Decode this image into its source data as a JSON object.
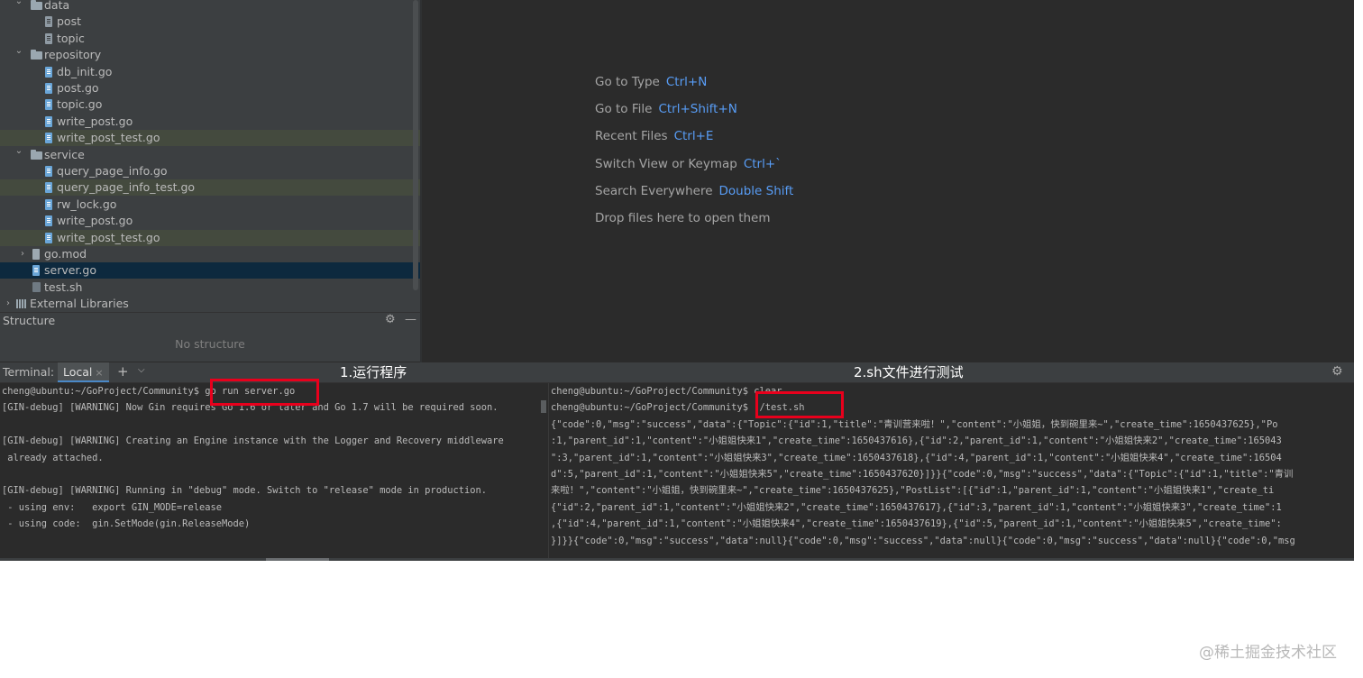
{
  "project_tree": [
    {
      "label": "data",
      "type": "folder",
      "chevron": "down"
    },
    {
      "label": "post",
      "type": "doc"
    },
    {
      "label": "topic",
      "type": "doc"
    },
    {
      "label": "repository",
      "type": "folder",
      "chevron": "down"
    },
    {
      "label": "db_init.go",
      "type": "gofile"
    },
    {
      "label": "post.go",
      "type": "gofile"
    },
    {
      "label": "topic.go",
      "type": "gofile"
    },
    {
      "label": "write_post.go",
      "type": "gofile"
    },
    {
      "label": "write_post_test.go",
      "type": "gofile",
      "highlight": true
    },
    {
      "label": "service",
      "type": "folder",
      "chevron": "down"
    },
    {
      "label": "query_page_info.go",
      "type": "gofile"
    },
    {
      "label": "query_page_info_test.go",
      "type": "gofile",
      "highlight": true
    },
    {
      "label": "rw_lock.go",
      "type": "gofile"
    },
    {
      "label": "write_post.go",
      "type": "gofile"
    },
    {
      "label": "write_post_test.go",
      "type": "gofile",
      "highlight": true
    },
    {
      "label": "go.mod",
      "type": "mod",
      "chevron": "right"
    },
    {
      "label": "server.go",
      "type": "gofile",
      "selected": true
    },
    {
      "label": "test.sh",
      "type": "sh"
    },
    {
      "label": "External Libraries",
      "type": "lib",
      "chevron": "right"
    }
  ],
  "structure": {
    "title": "Structure",
    "empty_text": "No structure"
  },
  "editor_hints": [
    {
      "label": "Go to Type",
      "key": "Ctrl+N"
    },
    {
      "label": "Go to File",
      "key": "Ctrl+Shift+N"
    },
    {
      "label": "Recent Files",
      "key": "Ctrl+E"
    },
    {
      "label": "Switch View or Keymap",
      "key": "Ctrl+`"
    },
    {
      "label": "Search Everywhere",
      "key": "Double Shift"
    },
    {
      "label": "Drop files here to open them",
      "key": ""
    }
  ],
  "terminal": {
    "title": "Terminal:",
    "tab_label": "Local",
    "tab_close": "×",
    "add_symbol": "+",
    "dropdown_symbol": "⌄",
    "annotation_left": "1.运行程序",
    "annotation_right": "2.sh文件进行测试",
    "left_lines": [
      "cheng@ubuntu:~/GoProject/Community$ go run server.go",
      "[GIN-debug] [WARNING] Now Gin requires Go 1.6 or later and Go 1.7 will be required soon.",
      "",
      "[GIN-debug] [WARNING] Creating an Engine instance with the Logger and Recovery middleware",
      " already attached.",
      "",
      "[GIN-debug] [WARNING] Running in \"debug\" mode. Switch to \"release\" mode in production.",
      " - using env:   export GIN_MODE=release",
      " - using code:  gin.SetMode(gin.ReleaseMode)"
    ],
    "right_lines": [
      "cheng@ubuntu:~/GoProject/Community$ clear",
      "cheng@ubuntu:~/GoProject/Community$ ./test.sh",
      "{\"code\":0,\"msg\":\"success\",\"data\":{\"Topic\":{\"id\":1,\"title\":\"青训营来啦！\",\"content\":\"小姐姐，快到碗里来~\",\"create_time\":1650437625},\"Po",
      ":1,\"parent_id\":1,\"content\":\"小姐姐快来1\",\"create_time\":1650437616},{\"id\":2,\"parent_id\":1,\"content\":\"小姐姐快来2\",\"create_time\":165043",
      "\":3,\"parent_id\":1,\"content\":\"小姐姐快来3\",\"create_time\":1650437618},{\"id\":4,\"parent_id\":1,\"content\":\"小姐姐快来4\",\"create_time\":16504",
      "d\":5,\"parent_id\":1,\"content\":\"小姐姐快来5\",\"create_time\":1650437620}]}}{\"code\":0,\"msg\":\"success\",\"data\":{\"Topic\":{\"id\":1,\"title\":\"青训",
      "来啦！\",\"content\":\"小姐姐，快到碗里来~\",\"create_time\":1650437625},\"PostList\":[{\"id\":1,\"parent_id\":1,\"content\":\"小姐姐快来1\",\"create_ti",
      "{\"id\":2,\"parent_id\":1,\"content\":\"小姐姐快来2\",\"create_time\":1650437617},{\"id\":3,\"parent_id\":1,\"content\":\"小姐姐快来3\",\"create_time\":1",
      ",{\"id\":4,\"parent_id\":1,\"content\":\"小姐姐快来4\",\"create_time\":1650437619},{\"id\":5,\"parent_id\":1,\"content\":\"小姐姐快来5\",\"create_time\":",
      "}]}}{\"code\":0,\"msg\":\"success\",\"data\":null}{\"code\":0,\"msg\":\"success\",\"data\":null}{\"code\":0,\"msg\":\"success\",\"data\":null}{\"code\":0,\"msg"
    ]
  },
  "watermark": "@稀土掘金技术社区",
  "colors": {
    "ide_bg": "#2b2b2b",
    "panel_bg": "#3c3f41",
    "selection": "#0d293e",
    "highlight": "#444a3e",
    "key_blue": "#589df6",
    "annotation_box": "#e8001c"
  }
}
